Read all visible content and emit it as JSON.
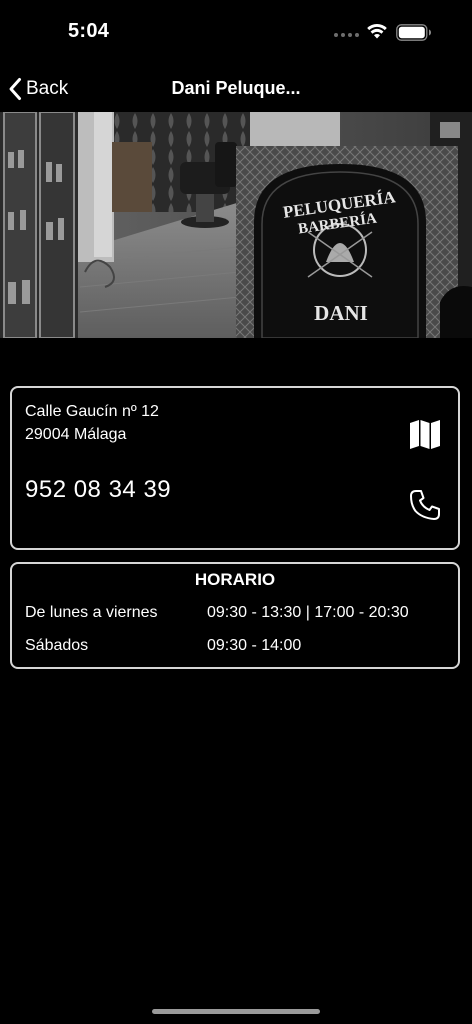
{
  "status_bar": {
    "time": "5:04"
  },
  "nav": {
    "back_label": "Back",
    "title": "Dani Peluque..."
  },
  "hero": {
    "sign_line1": "PELUQUERÍA",
    "sign_line2": "BARBERÍA",
    "sign_name": "DANI"
  },
  "contact": {
    "address_line1": "Calle Gaucín nº 12",
    "address_line2": "29004 Málaga",
    "phone": "952 08 34 39"
  },
  "hours": {
    "title": "HORARIO",
    "rows": [
      {
        "day": "De lunes a viernes",
        "time": "09:30 - 13:30 | 17:00 - 20:30"
      },
      {
        "day": "Sábados",
        "time": "09:30 - 14:00"
      }
    ]
  },
  "colors": {
    "background": "#000000",
    "card_border": "#d6d6d6",
    "text": "#ffffff"
  },
  "icons": {
    "map": "map-icon",
    "phone": "phone-icon",
    "back": "chevron-left-icon"
  }
}
